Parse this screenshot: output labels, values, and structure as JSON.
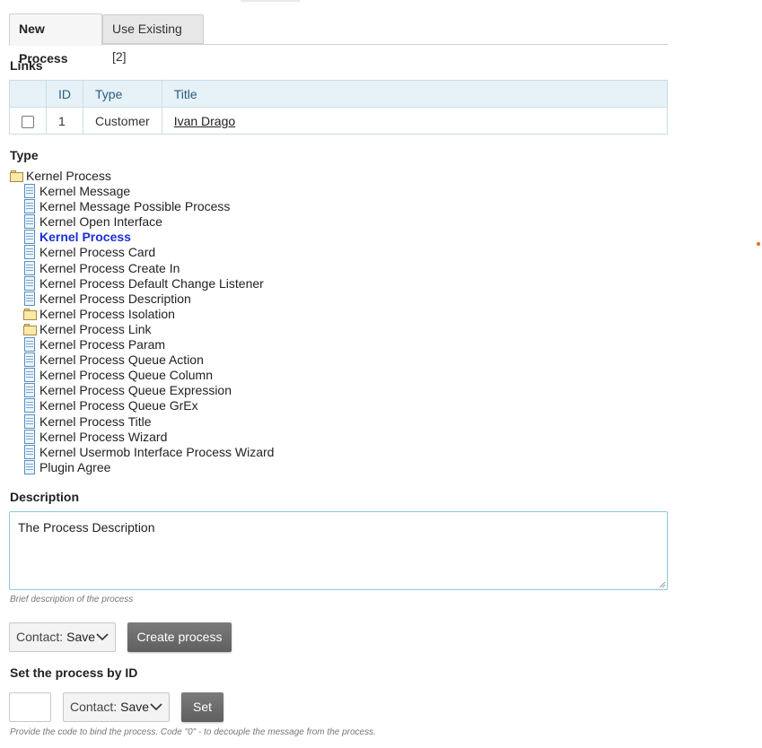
{
  "tabs": [
    {
      "label": "New Process"
    },
    {
      "label": "Use Existing [2]"
    }
  ],
  "links": {
    "title": "Links",
    "columns": [
      "ID",
      "Type",
      "Title"
    ],
    "rows": [
      {
        "id": "1",
        "type": "Customer",
        "title": "Ivan Drago",
        "checked": false
      }
    ]
  },
  "type_section": {
    "title": "Type",
    "root": "Kernel Process",
    "items": [
      {
        "label": "Kernel Message",
        "icon": "doc-icon"
      },
      {
        "label": "Kernel Message Possible Process",
        "icon": "doc-icon"
      },
      {
        "label": "Kernel Open Interface",
        "icon": "doc-icon"
      },
      {
        "label": "Kernel Process",
        "icon": "doc-icon",
        "selected": true
      },
      {
        "label": "Kernel Process Card",
        "icon": "doc-icon"
      },
      {
        "label": "Kernel Process Create In",
        "icon": "doc-icon"
      },
      {
        "label": "Kernel Process Default Change Listener",
        "icon": "doc-icon"
      },
      {
        "label": "Kernel Process Description",
        "icon": "doc-icon"
      },
      {
        "label": "Kernel Process Isolation",
        "icon": "folder-icon"
      },
      {
        "label": "Kernel Process Link",
        "icon": "folder-icon"
      },
      {
        "label": "Kernel Process Param",
        "icon": "doc-icon"
      },
      {
        "label": "Kernel Process Queue Action",
        "icon": "doc-icon"
      },
      {
        "label": "Kernel Process Queue Column",
        "icon": "doc-icon"
      },
      {
        "label": "Kernel Process Queue Expression",
        "icon": "doc-icon"
      },
      {
        "label": "Kernel Process Queue GrEx",
        "icon": "doc-icon"
      },
      {
        "label": "Kernel Process Title",
        "icon": "doc-icon"
      },
      {
        "label": "Kernel Process Wizard",
        "icon": "doc-icon"
      },
      {
        "label": "Kernel Usermob Interface Process Wizard",
        "icon": "doc-icon"
      },
      {
        "label": "Plugin Agree",
        "icon": "doc-icon"
      }
    ]
  },
  "description": {
    "title": "Description",
    "value": "The Process Description",
    "hint": "Brief description of the process"
  },
  "create": {
    "contact_label": "Contact:",
    "contact_value": "Save",
    "button": "Create process"
  },
  "set_by_id": {
    "title": "Set the process by ID",
    "value": "",
    "contact_label": "Contact:",
    "contact_value": "Save",
    "button": "Set",
    "hint": "Provide the code to bind the process. Code \"0\" - to decouple the message from the process."
  }
}
